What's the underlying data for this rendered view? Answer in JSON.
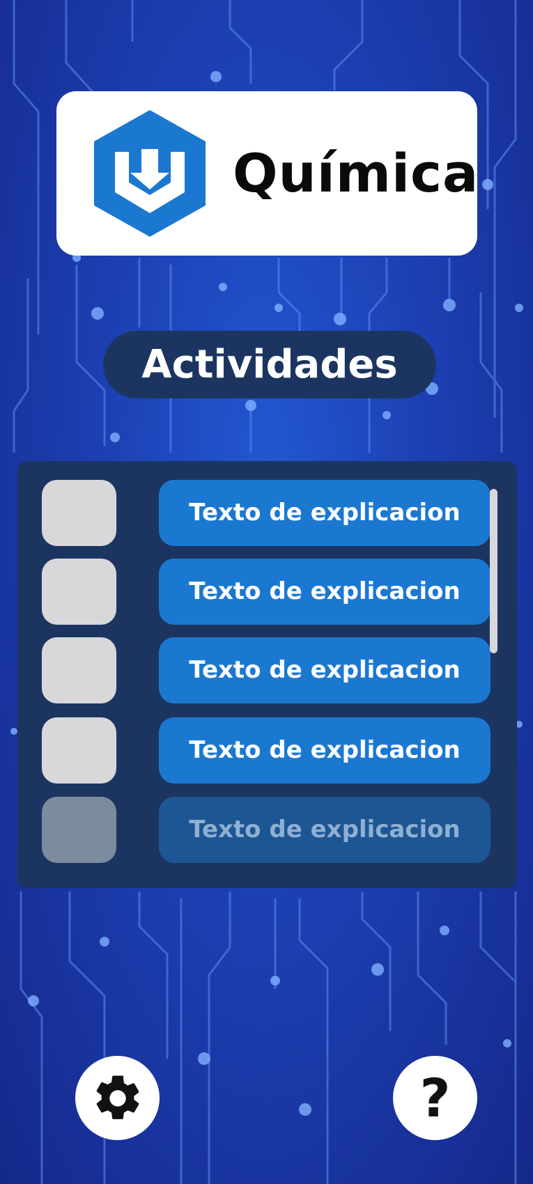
{
  "app": {
    "title": "Química",
    "logo_icon": "hexagon-download-logo-icon",
    "brand_color": "#1b78d1"
  },
  "section": {
    "title": "Actividades"
  },
  "activities": [
    {
      "label": "Texto de explicacion",
      "checked": false
    },
    {
      "label": "Texto de explicacion",
      "checked": false
    },
    {
      "label": "Texto de explicacion",
      "checked": false
    },
    {
      "label": "Texto de explicacion",
      "checked": false
    },
    {
      "label": "Texto de explicacion",
      "checked": false
    }
  ],
  "footer": {
    "settings_icon": "gear-icon",
    "help_icon": "question-mark-icon",
    "help_label": "?"
  }
}
